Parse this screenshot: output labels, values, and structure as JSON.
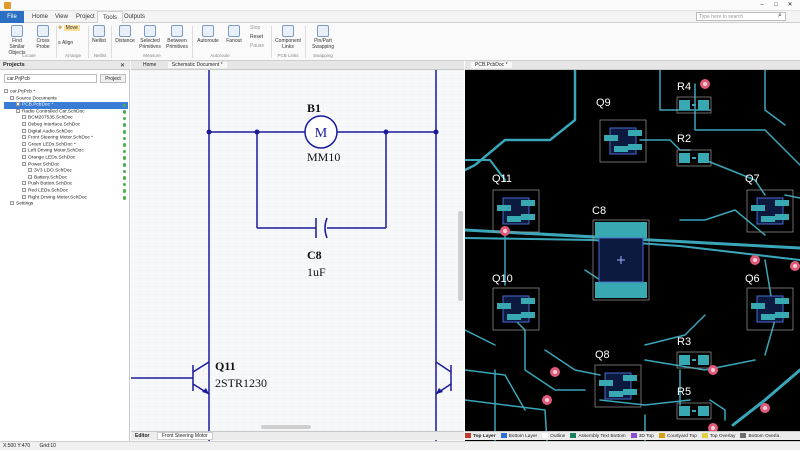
{
  "app": {
    "tabs": [
      "File",
      "Home",
      "View",
      "Project",
      "Tools",
      "Outputs"
    ],
    "active_tab": "Tools",
    "search_placeholder": "Type here to search"
  },
  "ribbon": {
    "buttons": [
      {
        "label": "Find Similar Objects",
        "icon": "find-similar-icon"
      },
      {
        "label": "Cross Probe",
        "icon": "cross-probe-icon"
      },
      {
        "label": "Move",
        "icon": "move-icon"
      },
      {
        "label": "Align",
        "icon": "align-icon"
      },
      {
        "label": "Netlist",
        "icon": "netlist-icon"
      },
      {
        "label": "Distance",
        "icon": "distance-icon"
      },
      {
        "label": "Selected Primitives",
        "icon": "selected-primitives-icon"
      },
      {
        "label": "Between Primitives",
        "icon": "between-primitives-icon"
      },
      {
        "label": "Autoroute",
        "icon": "autoroute-icon"
      },
      {
        "label": "Fanout",
        "icon": "fanout-icon"
      },
      {
        "label": "Stop",
        "icon": "stop-icon"
      },
      {
        "label": "Reset",
        "icon": "reset-icon"
      },
      {
        "label": "Pause",
        "icon": "pause-icon"
      },
      {
        "label": "Component Links",
        "icon": "component-links-icon"
      },
      {
        "label": "Pin/Part Swapping",
        "icon": "pin-swap-icon"
      }
    ],
    "groups": [
      "Locate",
      "Arrange",
      "Netlist",
      "Measure",
      "Autoroute",
      "PCB Links",
      "Swapping"
    ]
  },
  "projects": {
    "title": "Projects",
    "input_value": "car.PrjPcb",
    "project_button": "Project",
    "tree": [
      {
        "label": "car.PrjPcb *",
        "indent": 0
      },
      {
        "label": "Source Documents",
        "indent": 1
      },
      {
        "label": "PCB.PcbDoc *",
        "indent": 2,
        "selected": true
      },
      {
        "label": "Radio Controlled Car.SchDoc",
        "indent": 2
      },
      {
        "label": "BCM207535.SchDoc",
        "indent": 3
      },
      {
        "label": "Debug Interface.SchDoc",
        "indent": 3
      },
      {
        "label": "Digital Audio.SchDoc",
        "indent": 3
      },
      {
        "label": "Front Steering Motor.SchDoc *",
        "indent": 3
      },
      {
        "label": "Green LEDs.SchDoc *",
        "indent": 3
      },
      {
        "label": "Left Driving Motor.SchDoc",
        "indent": 3
      },
      {
        "label": "Orange LEDs.SchDoc",
        "indent": 3
      },
      {
        "label": "Power.SchDoc",
        "indent": 3
      },
      {
        "label": "3V3 LDO.SchDoc",
        "indent": 4
      },
      {
        "label": "Battery.SchDoc",
        "indent": 4
      },
      {
        "label": "Push Button.SchDoc",
        "indent": 3
      },
      {
        "label": "Red LEDs.SchDoc",
        "indent": 3
      },
      {
        "label": "Right Driving Motor.SchDoc",
        "indent": 3
      },
      {
        "label": "Settings",
        "indent": 1
      }
    ]
  },
  "schematic": {
    "tab_home": "Home",
    "tab_doc": "Schematic Document *",
    "bottom_editor": "Editor",
    "bottom_sheet": "Front Steering Motor",
    "components": {
      "b1_ref": "B1",
      "b1_val": "MM10",
      "c8_ref": "C8",
      "c8_val": "1uF",
      "q11_ref": "Q11",
      "q11_val": "2STR1230"
    }
  },
  "pcb": {
    "tab_label": "PCB.PcbDoc *",
    "refs": {
      "r4": "R4",
      "r2": "R2",
      "q9": "Q9",
      "q11": "Q11",
      "q7": "Q7",
      "c8": "C8",
      "q10": "Q10",
      "q6": "Q6",
      "r3": "R3",
      "q8": "Q8",
      "r5": "R5"
    },
    "layers": [
      {
        "name": "Top Layer",
        "color": "#c0392b"
      },
      {
        "name": "Bottom Layer",
        "color": "#2f6fd1"
      },
      {
        "name": "Outline",
        "color": "#ffffff"
      },
      {
        "name": "Assembly Text Bottom",
        "color": "#1a7f5a"
      },
      {
        "name": "3D Top",
        "color": "#8a4fd1"
      },
      {
        "name": "Courtyard Top",
        "color": "#d4a017"
      },
      {
        "name": "Top Overlay",
        "color": "#e0d040"
      },
      {
        "name": "Bottom Overla",
        "color": "#6d6d6d"
      }
    ],
    "colors": {
      "trace": "#3aa6b9",
      "pad": "#38a9b3",
      "via": "#e15a7a",
      "silk": "#ffffff"
    }
  },
  "status": {
    "coords": "X:500 Y:470",
    "grid": "Grid:10"
  }
}
